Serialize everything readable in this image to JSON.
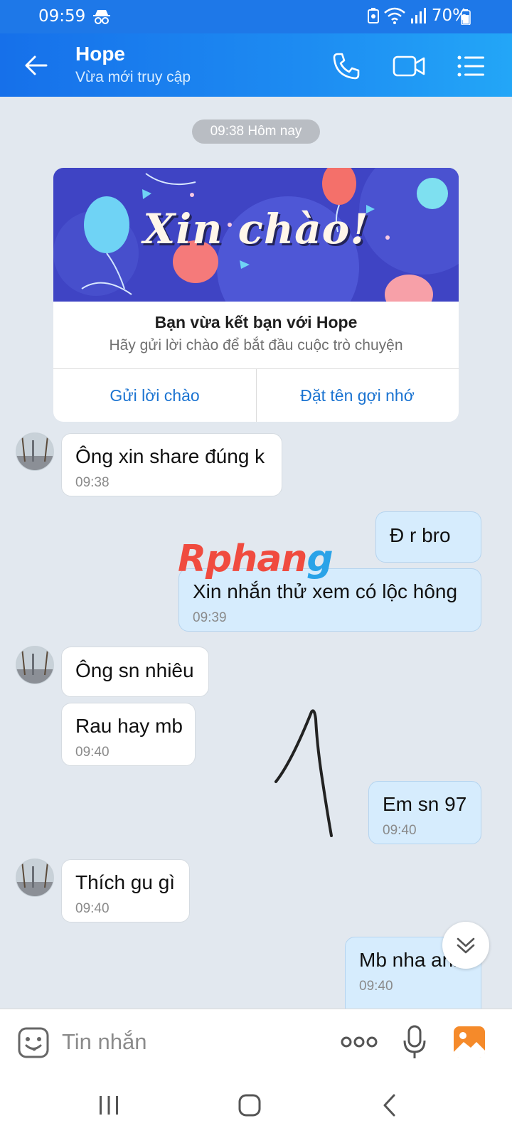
{
  "status_bar": {
    "time": "09:59",
    "battery_percent": "70%",
    "icons": [
      "incognito-icon",
      "battery-saver-icon",
      "wifi-icon",
      "signal-icon",
      "battery-icon"
    ]
  },
  "header": {
    "contact_name": "Hope",
    "status_text": "Vừa mới truy cập",
    "icons": [
      "back-arrow-icon",
      "phone-call-icon",
      "video-call-icon",
      "menu-list-icon"
    ],
    "accent_color": "#1e78e8"
  },
  "chat": {
    "date_label": "09:38 Hôm nay",
    "greeting_card": {
      "banner_text": "Xin chào!",
      "title": "Bạn vừa kết bạn với Hope",
      "description": "Hãy gửi lời chào để bắt đầu cuộc trò chuyện",
      "button_left": "Gửi lời chào",
      "button_right": "Đặt tên gợi nhớ"
    },
    "messages": [
      {
        "direction": "in",
        "text": "Ông xin share đúng k",
        "time": "09:38"
      },
      {
        "direction": "out",
        "text": "Đ r bro",
        "time": ""
      },
      {
        "direction": "out",
        "text": "Xin nhắn thử xem có lộc hông",
        "time": "09:39"
      },
      {
        "direction": "in",
        "text": "Ông sn nhiêu",
        "time": ""
      },
      {
        "direction": "in",
        "text": "Rau hay mb",
        "time": "09:40"
      },
      {
        "direction": "out",
        "text": "Em sn 97",
        "time": "09:40"
      },
      {
        "direction": "in",
        "text": "Thích gu gì",
        "time": "09:40"
      },
      {
        "direction": "out",
        "text": "Mb nha anh",
        "time": "09:40"
      }
    ],
    "watermark": {
      "part1": "Rphan",
      "part2": "g"
    }
  },
  "input_bar": {
    "placeholder": "Tin nhắn",
    "icons": [
      "sticker-icon",
      "more-options-icon",
      "microphone-icon",
      "image-gallery-icon"
    ]
  },
  "nav_bar": {
    "icons": [
      "recent-apps-icon",
      "home-icon",
      "back-icon"
    ]
  }
}
